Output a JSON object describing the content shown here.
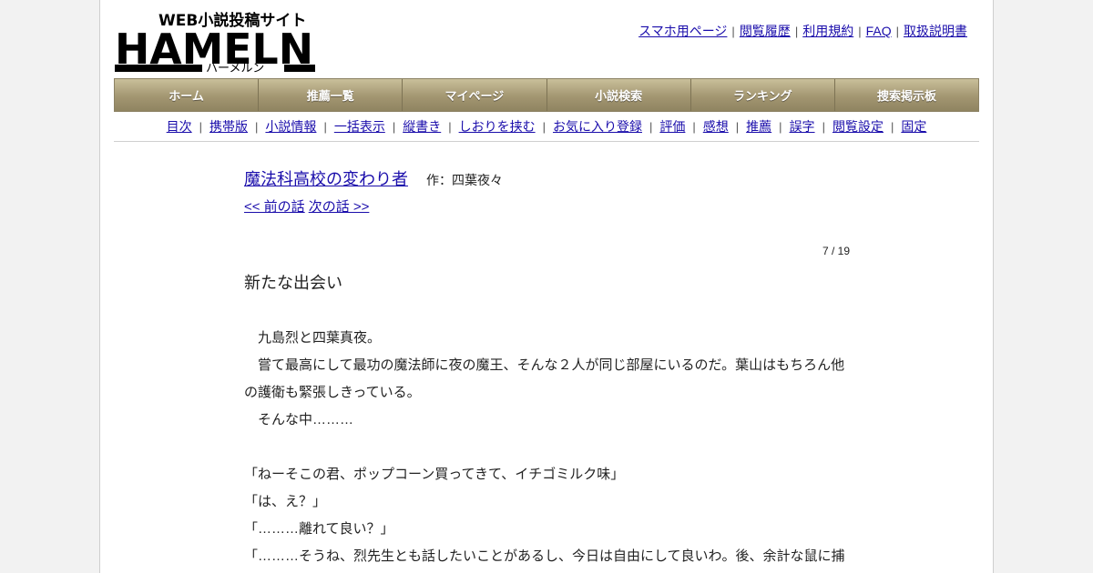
{
  "site": {
    "logo_top_text": "WEB小説投稿サイト",
    "logo_word": "HAMELN",
    "logo_kana": "ハーメルン"
  },
  "header_links": [
    "スマホ用ページ",
    "閲覧履歴",
    "利用規約",
    "FAQ",
    "取扱説明書"
  ],
  "main_nav": [
    "ホーム",
    "推薦一覧",
    "マイページ",
    "小説検索",
    "ランキング",
    "捜索掲示板"
  ],
  "sub_nav": [
    "目次",
    "携帯版",
    "小説情報",
    "一括表示",
    "縦書き",
    "しおりを挟む",
    "お気に入り登録",
    "評価",
    "感想",
    "推薦",
    "誤字",
    "閲覧設定",
    "固定"
  ],
  "story": {
    "title": "魔法科高校の変わり者",
    "author": "作：四葉夜々",
    "prev": "<< 前の話",
    "next": "次の話 >>",
    "episode_count": "7 / 19",
    "episode_title": "新たな出会い",
    "paragraphs": [
      "　九島烈と四葉真夜。",
      "　嘗て最高にして最功の魔法師に夜の魔王、そんな２人が同じ部屋にいるのだ。葉山はもちろん他の護衛も緊張しきっている。",
      "　そんな中………",
      "",
      "「ねーそこの君、ポップコーン買ってきて、イチゴミルク味」",
      "「は、え？」",
      "「………離れて良い？」",
      "「………そうね、烈先生とも話したいことがあるし、今日は自由にして良いわ。後、余計な鼠に捕まらないように警護は雇って良いわよ」"
    ]
  },
  "colors": {
    "link": "#1a0dab",
    "nav_gold": "#a39671",
    "page_bg": "#f2f2f2"
  }
}
